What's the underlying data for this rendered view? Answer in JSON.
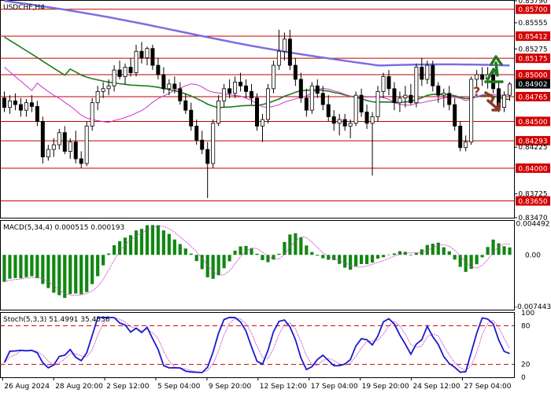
{
  "chart_data": {
    "type": "candlestick",
    "title": "USDCHF,H4",
    "price_axis": {
      "ticks": [
        "0.85790",
        "0.85555",
        "0.85275",
        "0.84990",
        "0.84725",
        "0.84475",
        "0.84225",
        "0.83970",
        "0.83725",
        "0.83470"
      ],
      "range": [
        0.8347,
        0.8579
      ]
    },
    "levels": [
      {
        "label": "0.85700",
        "value": 0.857
      },
      {
        "label": "0.85412",
        "value": 0.85412
      },
      {
        "label": "0.85175",
        "value": 0.85175
      },
      {
        "label": "0.85000",
        "value": 0.85
      },
      {
        "label": "0.84765",
        "value": 0.84765
      },
      {
        "label": "0.84500",
        "value": 0.845
      },
      {
        "label": "0.84293",
        "value": 0.84293
      },
      {
        "label": "0.84000",
        "value": 0.84
      },
      {
        "label": "0.83650",
        "value": 0.8365
      }
    ],
    "current_price": {
      "label": "0.84902",
      "value": 0.84902
    },
    "time_labels": [
      "26 Aug 2024",
      "28 Aug 20:00",
      "2 Sep 12:00",
      "5 Sep 04:00",
      "9 Sep 20:00",
      "12 Sep 12:00",
      "17 Sep 04:00",
      "19 Sep 20:00",
      "24 Sep 12:00",
      "27 Sep 04:00"
    ],
    "ohlc": [
      [
        0.8475,
        0.8482,
        0.846,
        0.8465
      ],
      [
        0.8465,
        0.8478,
        0.8458,
        0.8472
      ],
      [
        0.8472,
        0.848,
        0.8462,
        0.8468
      ],
      [
        0.8468,
        0.8475,
        0.8455,
        0.8462
      ],
      [
        0.8462,
        0.8474,
        0.8455,
        0.847
      ],
      [
        0.847,
        0.8478,
        0.846,
        0.8466
      ],
      [
        0.8466,
        0.8472,
        0.8445,
        0.845
      ],
      [
        0.845,
        0.8455,
        0.8405,
        0.8412
      ],
      [
        0.8412,
        0.8425,
        0.8408,
        0.842
      ],
      [
        0.842,
        0.8432,
        0.8412,
        0.8425
      ],
      [
        0.8425,
        0.8442,
        0.842,
        0.8438
      ],
      [
        0.8438,
        0.8445,
        0.8415,
        0.8418
      ],
      [
        0.8418,
        0.8432,
        0.841,
        0.8428
      ],
      [
        0.8428,
        0.844,
        0.8405,
        0.841
      ],
      [
        0.841,
        0.8418,
        0.84,
        0.8405
      ],
      [
        0.8405,
        0.845,
        0.8402,
        0.8445
      ],
      [
        0.8445,
        0.8475,
        0.844,
        0.847
      ],
      [
        0.847,
        0.8488,
        0.8462,
        0.8482
      ],
      [
        0.8482,
        0.8492,
        0.8475,
        0.8485
      ],
      [
        0.8485,
        0.8495,
        0.8478,
        0.8488
      ],
      [
        0.8488,
        0.851,
        0.8482,
        0.8505
      ],
      [
        0.8505,
        0.8515,
        0.8495,
        0.8498
      ],
      [
        0.8498,
        0.8512,
        0.849,
        0.8508
      ],
      [
        0.8508,
        0.8518,
        0.8498,
        0.8502
      ],
      [
        0.8502,
        0.8532,
        0.8498,
        0.8525
      ],
      [
        0.8525,
        0.8535,
        0.8512,
        0.8518
      ],
      [
        0.8518,
        0.853,
        0.851,
        0.8528
      ],
      [
        0.8528,
        0.8532,
        0.8505,
        0.851
      ],
      [
        0.851,
        0.8518,
        0.8495,
        0.85
      ],
      [
        0.85,
        0.8508,
        0.848,
        0.8485
      ],
      [
        0.8485,
        0.8495,
        0.8478,
        0.849
      ],
      [
        0.849,
        0.8498,
        0.848,
        0.8485
      ],
      [
        0.8485,
        0.8492,
        0.8468,
        0.8472
      ],
      [
        0.8472,
        0.848,
        0.8458,
        0.8462
      ],
      [
        0.8462,
        0.847,
        0.844,
        0.8445
      ],
      [
        0.8445,
        0.8452,
        0.8425,
        0.843
      ],
      [
        0.843,
        0.844,
        0.8415,
        0.842
      ],
      [
        0.842,
        0.8428,
        0.8368,
        0.8405
      ],
      [
        0.8405,
        0.8452,
        0.84,
        0.8448
      ],
      [
        0.8448,
        0.8478,
        0.8445,
        0.8472
      ],
      [
        0.8472,
        0.849,
        0.8465,
        0.8485
      ],
      [
        0.8485,
        0.8495,
        0.8475,
        0.848
      ],
      [
        0.848,
        0.8498,
        0.8475,
        0.8492
      ],
      [
        0.8492,
        0.8502,
        0.8482,
        0.8488
      ],
      [
        0.8488,
        0.8495,
        0.8475,
        0.8482
      ],
      [
        0.8482,
        0.849,
        0.8468,
        0.8475
      ],
      [
        0.8475,
        0.848,
        0.844,
        0.8445
      ],
      [
        0.8445,
        0.8458,
        0.8428,
        0.8452
      ],
      [
        0.8452,
        0.849,
        0.8448,
        0.8485
      ],
      [
        0.8485,
        0.8515,
        0.848,
        0.851
      ],
      [
        0.851,
        0.8548,
        0.8505,
        0.8525
      ],
      [
        0.8525,
        0.8545,
        0.8515,
        0.8538
      ],
      [
        0.8538,
        0.8548,
        0.8505,
        0.851
      ],
      [
        0.851,
        0.8518,
        0.8488,
        0.8495
      ],
      [
        0.8495,
        0.8502,
        0.847,
        0.8475
      ],
      [
        0.8475,
        0.8485,
        0.8455,
        0.8462
      ],
      [
        0.8462,
        0.8492,
        0.8458,
        0.8488
      ],
      [
        0.8488,
        0.8495,
        0.8475,
        0.848
      ],
      [
        0.848,
        0.8488,
        0.8462,
        0.8468
      ],
      [
        0.8468,
        0.8478,
        0.845,
        0.8455
      ],
      [
        0.8455,
        0.8462,
        0.844,
        0.8448
      ],
      [
        0.8448,
        0.8458,
        0.8435,
        0.8452
      ],
      [
        0.8452,
        0.8458,
        0.844,
        0.8445
      ],
      [
        0.8445,
        0.8452,
        0.8432,
        0.8448
      ],
      [
        0.8448,
        0.8482,
        0.8445,
        0.8478
      ],
      [
        0.8478,
        0.8485,
        0.8455,
        0.846
      ],
      [
        0.846,
        0.8468,
        0.8442,
        0.8448
      ],
      [
        0.8448,
        0.846,
        0.8392,
        0.8455
      ],
      [
        0.8455,
        0.8488,
        0.845,
        0.8482
      ],
      [
        0.8482,
        0.8502,
        0.8475,
        0.8498
      ],
      [
        0.8498,
        0.8505,
        0.8478,
        0.8485
      ],
      [
        0.8485,
        0.8492,
        0.8462,
        0.847
      ],
      [
        0.847,
        0.8482,
        0.846,
        0.8475
      ],
      [
        0.8475,
        0.8488,
        0.8465,
        0.8478
      ],
      [
        0.8478,
        0.849,
        0.8468,
        0.847
      ],
      [
        0.847,
        0.8512,
        0.8465,
        0.8508
      ],
      [
        0.8508,
        0.8518,
        0.8488,
        0.8495
      ],
      [
        0.8495,
        0.8515,
        0.849,
        0.851
      ],
      [
        0.851,
        0.8515,
        0.8482,
        0.8488
      ],
      [
        0.8488,
        0.8492,
        0.847,
        0.8478
      ],
      [
        0.8478,
        0.8485,
        0.8465,
        0.848
      ],
      [
        0.848,
        0.8488,
        0.8462,
        0.8468
      ],
      [
        0.8468,
        0.8475,
        0.844,
        0.8445
      ],
      [
        0.8445,
        0.845,
        0.8418,
        0.8422
      ],
      [
        0.8422,
        0.8435,
        0.8418,
        0.8428
      ],
      [
        0.8428,
        0.8498,
        0.8425,
        0.8495
      ],
      [
        0.8495,
        0.8505,
        0.8485,
        0.85
      ],
      [
        0.85,
        0.8508,
        0.8488,
        0.8495
      ],
      [
        0.8495,
        0.8508,
        0.8485,
        0.85
      ],
      [
        0.85,
        0.8505,
        0.848,
        0.8485
      ],
      [
        0.8485,
        0.8492,
        0.846,
        0.8465
      ],
      [
        0.8465,
        0.8482,
        0.846,
        0.8478
      ],
      [
        0.8478,
        0.8492,
        0.8472,
        0.849
      ]
    ],
    "moving_averages": [
      {
        "color": "#7a6ee0",
        "period": 100
      },
      {
        "color": "#1f7a1f",
        "period": 50
      },
      {
        "color": "#cc33cc",
        "period": 20
      }
    ],
    "macd": {
      "label": "MACD(5,34,4) 0.000515 0.000193",
      "ticks": [
        "0.004492",
        "0.00",
        "-0.007443"
      ],
      "range": [
        -0.0079,
        0.0049
      ]
    },
    "stoch": {
      "label": "Stoch(5,3,3) 51.4991 35.4536",
      "ticks": [
        "100",
        "80",
        "20",
        "0"
      ],
      "levels": [
        80,
        20
      ]
    },
    "signals": {
      "up_color": "#1f7a1f",
      "down_color": "#8b3a2a",
      "question": "?"
    }
  }
}
